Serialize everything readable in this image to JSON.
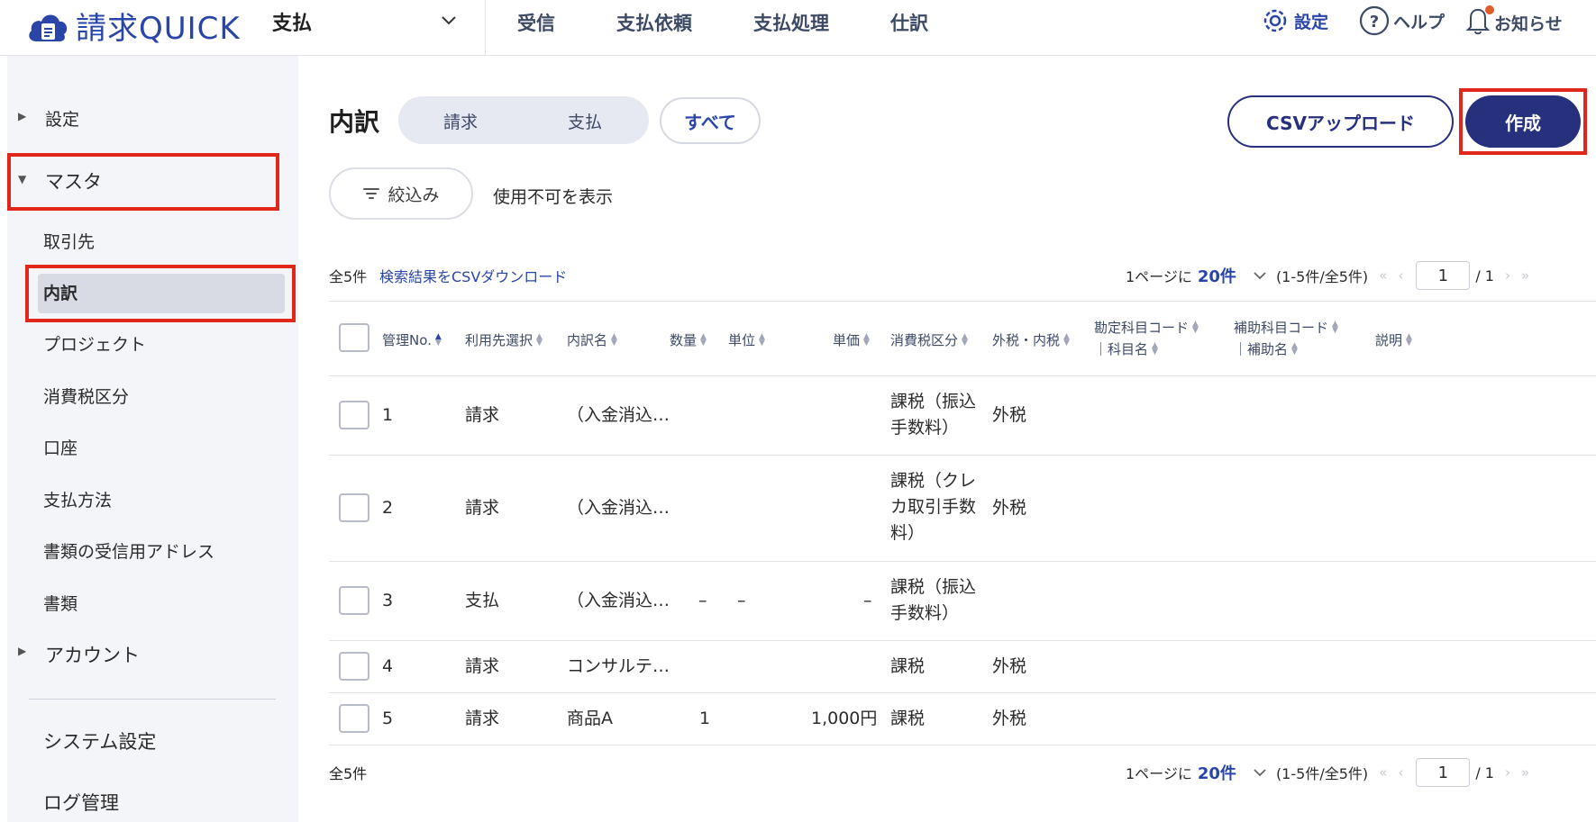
{
  "header": {
    "logo_text": "請求QUICK",
    "app_select": "支払",
    "nav": [
      "受信",
      "支払依頼",
      "支払処理",
      "仕訳"
    ],
    "settings_label": "設定",
    "help_label": "ヘルプ",
    "notify_label": "お知らせ"
  },
  "sidebar": {
    "settings": "設定",
    "master": "マスタ",
    "items": [
      "取引先",
      "内訳",
      "プロジェクト",
      "消費税区分",
      "口座",
      "支払方法",
      "書類の受信用アドレス",
      "書類"
    ],
    "account": "アカウント",
    "system_settings": "システム設定",
    "log_management": "ログ管理"
  },
  "main": {
    "title": "内訳",
    "segments": [
      "請求",
      "支払"
    ],
    "all_label": "すべて",
    "csv_upload": "CSVアップロード",
    "create": "作成",
    "filter_label": "絞込み",
    "show_disabled": "使用不可を表示",
    "total": "全5件",
    "csv_download": "検索結果をCSVダウンロード",
    "pager": {
      "per_page_prefix": "1ページに",
      "per_page": "20件",
      "range": "(1-5件/全5件)",
      "page": "1",
      "of": "/ 1"
    }
  },
  "table": {
    "headers": {
      "no": "管理No.",
      "user": "利用先選択",
      "name": "内訳名",
      "qty": "数量",
      "unit": "単位",
      "price": "単価",
      "tax": "消費税区分",
      "incl": "外税・内税",
      "acct_line1": "勘定科目コード",
      "acct_line2": "｜科目名",
      "sub_line1": "補助科目コード",
      "sub_line2": "｜補助名",
      "desc": "説明"
    },
    "rows": [
      {
        "no": "1",
        "user": "請求",
        "name": "（入金消込…",
        "qty": "",
        "unit": "",
        "price": "",
        "tax": "課税（振込\n手数料）",
        "incl": "外税"
      },
      {
        "no": "2",
        "user": "請求",
        "name": "（入金消込…",
        "qty": "",
        "unit": "",
        "price": "",
        "tax": "課税（クレ\nカ取引手数\n料）",
        "incl": "外税"
      },
      {
        "no": "3",
        "user": "支払",
        "name": "（入金消込…",
        "qty": "–",
        "unit": "–",
        "price": "–",
        "tax": "課税（振込\n手数料）",
        "incl": ""
      },
      {
        "no": "4",
        "user": "請求",
        "name": "コンサルテ…",
        "qty": "",
        "unit": "",
        "price": "",
        "tax": "課税",
        "incl": "外税"
      },
      {
        "no": "5",
        "user": "請求",
        "name": "商品A",
        "qty": "1",
        "unit": "",
        "price": "1,000円",
        "tax": "課税",
        "incl": "外税"
      }
    ]
  },
  "colors": {
    "brand": "#2a45a8",
    "primary_button": "#26307d",
    "highlight": "#e0271c",
    "sidebar_bg": "#f4f5f9"
  }
}
